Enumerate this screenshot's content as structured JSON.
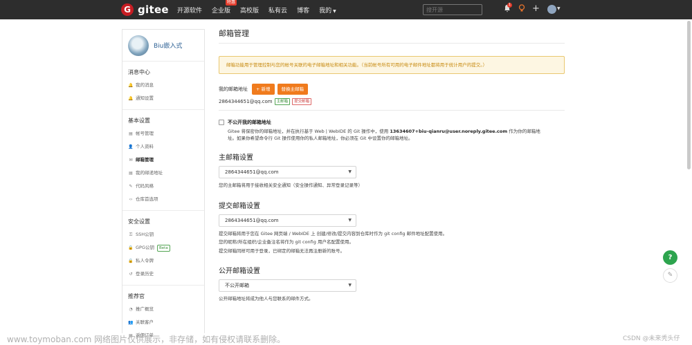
{
  "nav": {
    "logo_mark": "G",
    "logo_text": "gitee",
    "links": [
      "开源软件",
      "企业版",
      "高校版",
      "私有云",
      "博客",
      "我的"
    ],
    "enterprise_badge": "特惠",
    "search_placeholder": "搜开源",
    "notification_count": "1"
  },
  "sidebar": {
    "username": "Biu嵌入式",
    "sections": [
      {
        "title": "消息中心",
        "items": [
          {
            "icon": "bell-icon",
            "label": "我的消息"
          },
          {
            "icon": "bell-icon",
            "label": "通知设置"
          }
        ]
      },
      {
        "title": "基本设置",
        "items": [
          {
            "icon": "id-card-icon",
            "label": "帐号管理"
          },
          {
            "icon": "user-icon",
            "label": "个人资料"
          },
          {
            "icon": "mail-icon",
            "label": "邮箱管理"
          },
          {
            "icon": "address-icon",
            "label": "我的邮递地址"
          },
          {
            "icon": "brush-icon",
            "label": "代码风格"
          },
          {
            "icon": "code-icon",
            "label": "仓库首选项"
          }
        ]
      },
      {
        "title": "安全设置",
        "items": [
          {
            "icon": "key-icon",
            "label": "SSH公钥"
          },
          {
            "icon": "lock-icon",
            "label": "GPG公钥"
          },
          {
            "icon": "lock-icon",
            "label": "私人令牌"
          },
          {
            "icon": "history-icon",
            "label": "登录历史"
          }
        ]
      },
      {
        "title": "推荐官",
        "items": [
          {
            "icon": "chart-icon",
            "label": "推广概览"
          },
          {
            "icon": "users-icon",
            "label": "关联客户"
          },
          {
            "icon": "order-icon",
            "label": "返佣订单"
          }
        ]
      }
    ],
    "beta_label": "Beta"
  },
  "main": {
    "title": "邮箱管理",
    "notice": "邮箱功能用于管理控制与您的帐号关联的电子邮箱地址和相关功能。（当前帐号所有可用的电子邮件地址都将用于统计用户的提交。）",
    "my_email_label": "我的邮箱地址",
    "add_button": "+ 新增",
    "switch_button": "替换主邮箱",
    "email": "2864344651@qq.com",
    "tag_primary": "主邮箱",
    "tag_commit": "提交邮箱",
    "private_label": "不公开我的邮箱地址",
    "private_desc_1a": "Gitee 将保密你的邮箱地址，并在执行基于 Web | WebIDE 的 Git 操作中，使用 ",
    "private_noreply": "13634607+biu-qianru@user.noreply.gitee.com",
    "private_desc_1b": " 作为你的邮箱地",
    "private_desc_2": "址。如果你希望命令行 Git 操作使用你的私人邮箱地址，你必须在 Git 中设置你的邮箱地址。",
    "primary_heading": "主邮箱设置",
    "primary_select": "2864344651@qq.com",
    "primary_help": "您的主邮箱将用于接收相关安全通知（安全操作通知、异常登录记录等）",
    "commit_heading": "提交邮箱设置",
    "commit_select": "2864344651@qq.com",
    "commit_help_1": "提交邮箱将用于您在 Gitee 网页端 / WebIDE 上 创建/修改/提交内容到仓库时作为 git config 邮件地址配置使用。",
    "commit_help_2": "您的昵称/所在组织/企业备注名将作为 git config 用户名配置使用。",
    "commit_help_3": "提交邮箱同样可用于登录，已绑定的邮箱无法再注册新的账号。",
    "public_heading": "公开邮箱设置",
    "public_select": "不公开邮箱",
    "public_help": "公开邮箱地址将成为他人与您联系的邮件方式。"
  },
  "floating": {
    "help_icon": "?",
    "edit_icon": "✎"
  },
  "watermark": "www.toymoban.com 网络图片仅供展示，非存储，如有侵权请联系删除。",
  "csdn": "CSDN @未来秃头仔"
}
